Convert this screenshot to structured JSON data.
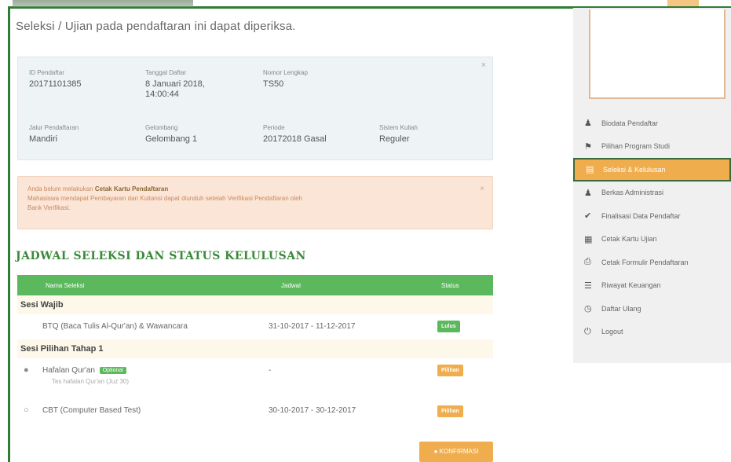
{
  "header": {
    "subtitle": "Seleksi / Ujian pada pendaftaran ini dapat diperiksa."
  },
  "info": {
    "cells": [
      {
        "label": "ID Pendaftar",
        "value": "20171101385"
      },
      {
        "label": "Tanggal Daftar",
        "value": "8 Januari 2018, 14:00:44"
      },
      {
        "label": "Nomor Lengkap",
        "value": "TS50"
      },
      {
        "label": "Jalur Pendaftaran",
        "value": "Mandiri"
      },
      {
        "label": "Gelombang",
        "value": "Gelombang 1"
      },
      {
        "label": "Periode",
        "value": "20172018 Gasal"
      },
      {
        "label": "Sistem Kuliah",
        "value": "Reguler"
      }
    ]
  },
  "alert": {
    "line1_prefix": "Anda belum melakukan",
    "line1_link": "Cetak Kartu Pendaftaran",
    "line2": "Mahasiswa mendapat Pembayaran dan Kuitansi dapat diunduh setelah Verifikasi Pendaftaran oleh",
    "line3": "Bank Verifikasi."
  },
  "section": {
    "title": "JADWAL SELEKSI DAN STATUS KELULUSAN"
  },
  "table": {
    "headers": {
      "name": "Nama Seleksi",
      "date": "Jadwal",
      "status": "Status"
    },
    "groups": [
      {
        "title": "Sesi Wajib",
        "rows": [
          {
            "bullet": "",
            "name": "BTQ (Baca Tulis Al-Qur'an) & Wawancara",
            "tag": "",
            "sub": "",
            "date": "31-10-2017 - 11-12-2017",
            "status": "Lulus",
            "status_color": "green"
          }
        ]
      },
      {
        "title": "Sesi Pilihan Tahap 1",
        "rows": [
          {
            "bullet": "●",
            "name": "Hafalan Qur'an",
            "tag": "Optional",
            "sub": "Tes hafalan Qur'an (Juz 30)",
            "date": "-",
            "status": "Pilihan",
            "status_color": "orange"
          },
          {
            "bullet": "○",
            "name": "CBT (Computer Based Test)",
            "tag": "",
            "sub": "",
            "date": "30-10-2017 - 30-12-2017",
            "status": "Pilihan",
            "status_color": "orange"
          }
        ]
      }
    ],
    "action_label": "● KONFIRMASI"
  },
  "sidebar": {
    "items": [
      {
        "icon": "user-icon",
        "glyph": "♟",
        "label": "Biodata Pendaftar",
        "active": false
      },
      {
        "icon": "bookmark-icon",
        "glyph": "⚑",
        "label": "Pilihan Program Studi",
        "active": false
      },
      {
        "icon": "document-icon",
        "glyph": "▤",
        "label": "Seleksi & Kelulusan",
        "active": true
      },
      {
        "icon": "user-add-icon",
        "glyph": "♟",
        "label": "Berkas Administrasi",
        "active": false
      },
      {
        "icon": "check-icon",
        "glyph": "✔",
        "label": "Finalisasi Data Pendaftar",
        "active": false
      },
      {
        "icon": "id-card-icon",
        "glyph": "▦",
        "label": "Cetak Kartu Ujian",
        "active": false
      },
      {
        "icon": "print-icon",
        "glyph": "⎙",
        "label": "Cetak Formulir Pendaftaran",
        "active": false
      },
      {
        "icon": "list-icon",
        "glyph": "☰",
        "label": "Riwayat Keuangan",
        "active": false
      },
      {
        "icon": "clock-icon",
        "glyph": "◷",
        "label": "Daftar Ulang",
        "active": false
      },
      {
        "icon": "logout-icon",
        "glyph": "⏻",
        "label": "Logout",
        "active": false
      }
    ]
  },
  "colors": {
    "green": "#5cb85c",
    "orange": "#f0ad4e",
    "alert_bg": "#fbe5d6",
    "info_bg": "#eef3f6"
  }
}
